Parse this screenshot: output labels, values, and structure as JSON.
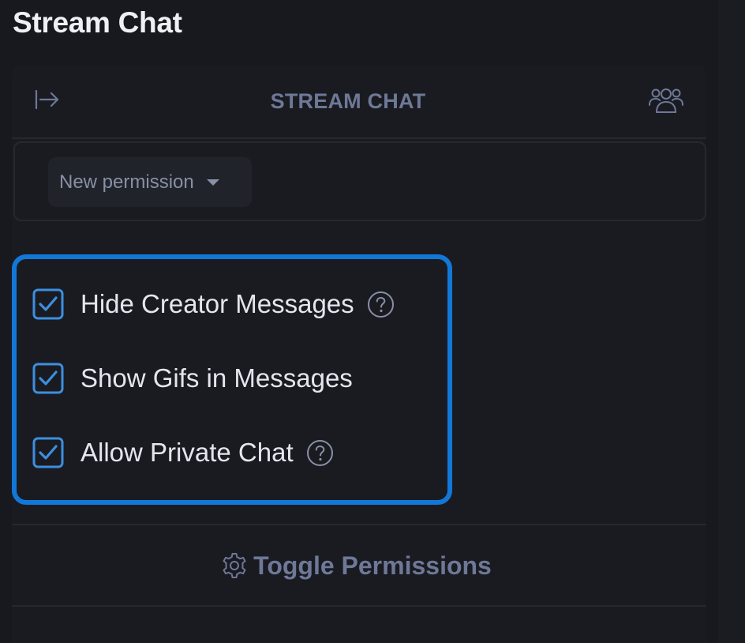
{
  "page": {
    "title": "Stream Chat"
  },
  "panel": {
    "header_title": "STREAM CHAT",
    "permission_select": {
      "selected": "New permission"
    },
    "options": [
      {
        "label": "Hide Creator Messages",
        "checked": true,
        "has_help": true
      },
      {
        "label": "Show Gifs in Messages",
        "checked": true,
        "has_help": false
      },
      {
        "label": "Allow Private Chat",
        "checked": true,
        "has_help": true
      }
    ],
    "toggle_permissions_label": "Toggle Permissions"
  },
  "icons": {
    "collapse": "collapse-right-icon",
    "users": "users-icon",
    "caret": "caret-down-icon",
    "checkbox": "checkbox-checked-icon",
    "help": "help-circle-icon",
    "gear": "gear-icon"
  },
  "colors": {
    "background": "#18191f",
    "panel": "#1a1b21",
    "accent_highlight": "#1278d8",
    "checkbox": "#3c8fe0",
    "muted_text": "#6e7897",
    "primary_text": "#e4e6ee"
  }
}
